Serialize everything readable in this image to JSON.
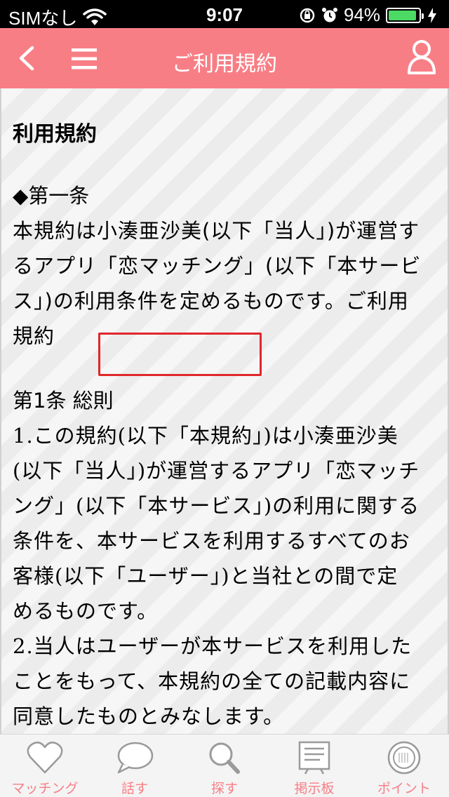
{
  "status_bar": {
    "carrier": "SIMなし",
    "time": "9:07",
    "battery_percent": "94%",
    "battery_level": 0.94,
    "icons": [
      "wifi-icon",
      "orientation-lock-icon",
      "alarm-icon",
      "battery-icon",
      "charging-icon"
    ]
  },
  "nav": {
    "title": "ご利用規約",
    "icons": [
      "back-chevron-icon",
      "menu-icon",
      "user-icon"
    ],
    "color": "#f87e86"
  },
  "content": {
    "doc_title": "利用規約",
    "article1_head": "◆第一条",
    "article1_lines": [
      "本規約は小湊亜沙美(以下「当人」)が運営す",
      "るアプリ「恋マッチング」(以下「本サービ",
      "ス」)の利用条件を定めるものです。ご利用",
      "規約"
    ],
    "section1_head": "第1条 総則",
    "section1_lines": [
      "1.この規約(以下「本規約」)は小湊亜沙美",
      "(以下「当人」)が運営するアプリ「恋マッチ",
      "ング」(以下「本サービス」)の利用に関する",
      "条件を、本サービスを利用するすべてのお",
      "客様(以下「ユーザー」)と当社との間で定",
      "めるものです。",
      "2.当人はユーザーが本サービスを利用した",
      "ことをもって、本規約の全ての記載内容に",
      "同意したものとみなします。"
    ],
    "highlight_color": "#e0262b"
  },
  "tabs": [
    {
      "label": "マッチング",
      "icon": "heart-icon"
    },
    {
      "label": "話す",
      "icon": "speech-bubble-icon"
    },
    {
      "label": "探す",
      "icon": "magnifier-icon"
    },
    {
      "label": "掲示板",
      "icon": "bulletin-board-icon"
    },
    {
      "label": "ポイント",
      "icon": "coin-icon"
    }
  ]
}
